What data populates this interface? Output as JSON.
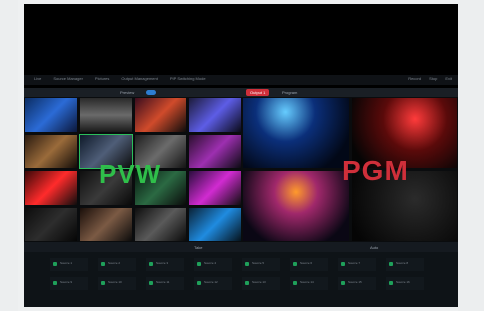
{
  "overlay": {
    "pvw": "PVW",
    "pgm": "PGM"
  },
  "top_menu": [
    "Live",
    "Source Manager",
    "Pictures",
    "Output Management",
    "PIP Switching Mode"
  ],
  "top_right": [
    "Record",
    "Stop",
    "Exit"
  ],
  "pvw_bar": {
    "label": "Preview",
    "chip_left": "",
    "chip_right": ""
  },
  "pgm_bar": {
    "label": "Program",
    "chip_left": "Output 1",
    "chip_right": ""
  },
  "pvw_grid": {
    "tiles": 16
  },
  "pgm_grid": {
    "tiles": 4
  },
  "controls": {
    "left_label": "Take",
    "right_label": "Auto"
  },
  "bottom_tiles": [
    "Source 1",
    "Source 2",
    "Source 3",
    "Source 4",
    "Source 5",
    "Source 6",
    "Source 7",
    "Source 8",
    "Source 9",
    "Source 10",
    "Source 11",
    "Source 12",
    "Source 13",
    "Source 14",
    "Source 15",
    "Source 16"
  ],
  "colors": {
    "pvw_green": "#2fbf4a",
    "pgm_red": "#cf2f3a",
    "accent_blue": "#2d7dd2"
  }
}
